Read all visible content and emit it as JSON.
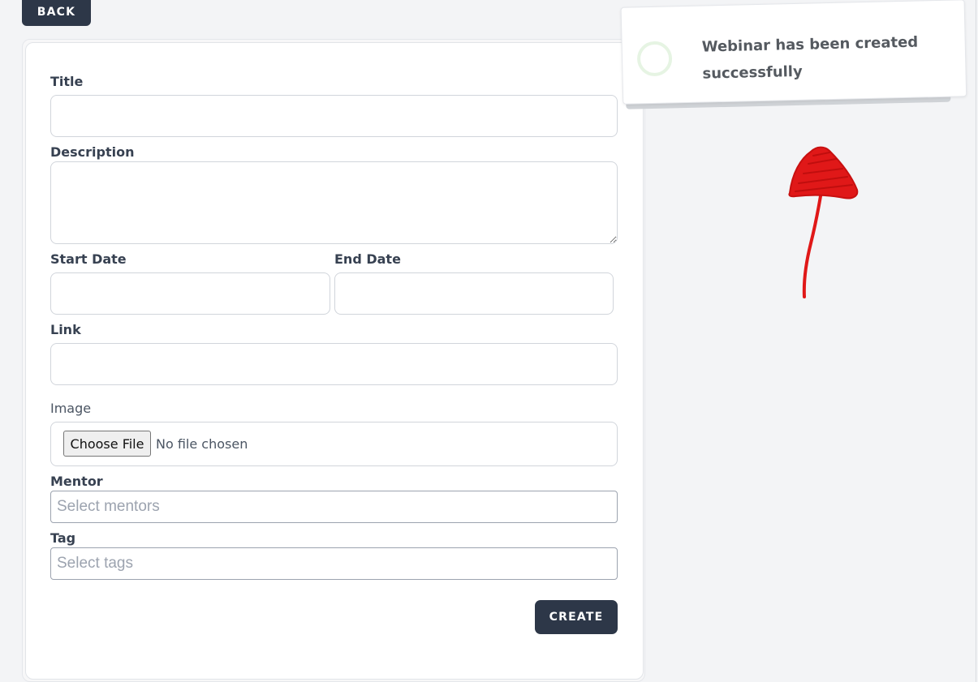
{
  "back_button": {
    "label": "BACK"
  },
  "form": {
    "title": {
      "label": "Title",
      "value": ""
    },
    "description": {
      "label": "Description",
      "value": ""
    },
    "start_date": {
      "label": "Start Date",
      "value": ""
    },
    "end_date": {
      "label": "End Date",
      "value": ""
    },
    "link": {
      "label": "Link",
      "value": ""
    },
    "image": {
      "label": "Image",
      "button_label": "Choose File",
      "status": "No file chosen"
    },
    "mentor": {
      "label": "Mentor",
      "placeholder": "Select mentors"
    },
    "tag": {
      "label": "Tag",
      "placeholder": "Select tags"
    },
    "submit_label": "CREATE"
  },
  "toast": {
    "message": "Webinar has been created successfully",
    "icon": "success-circle-icon"
  },
  "annotation": {
    "shape": "red-arrow-icon",
    "color": "#e01818"
  },
  "colors": {
    "button_bg": "#2d3748",
    "page_bg": "#f3f4f6",
    "card_bg": "#ffffff",
    "input_border": "#d1d5db"
  }
}
